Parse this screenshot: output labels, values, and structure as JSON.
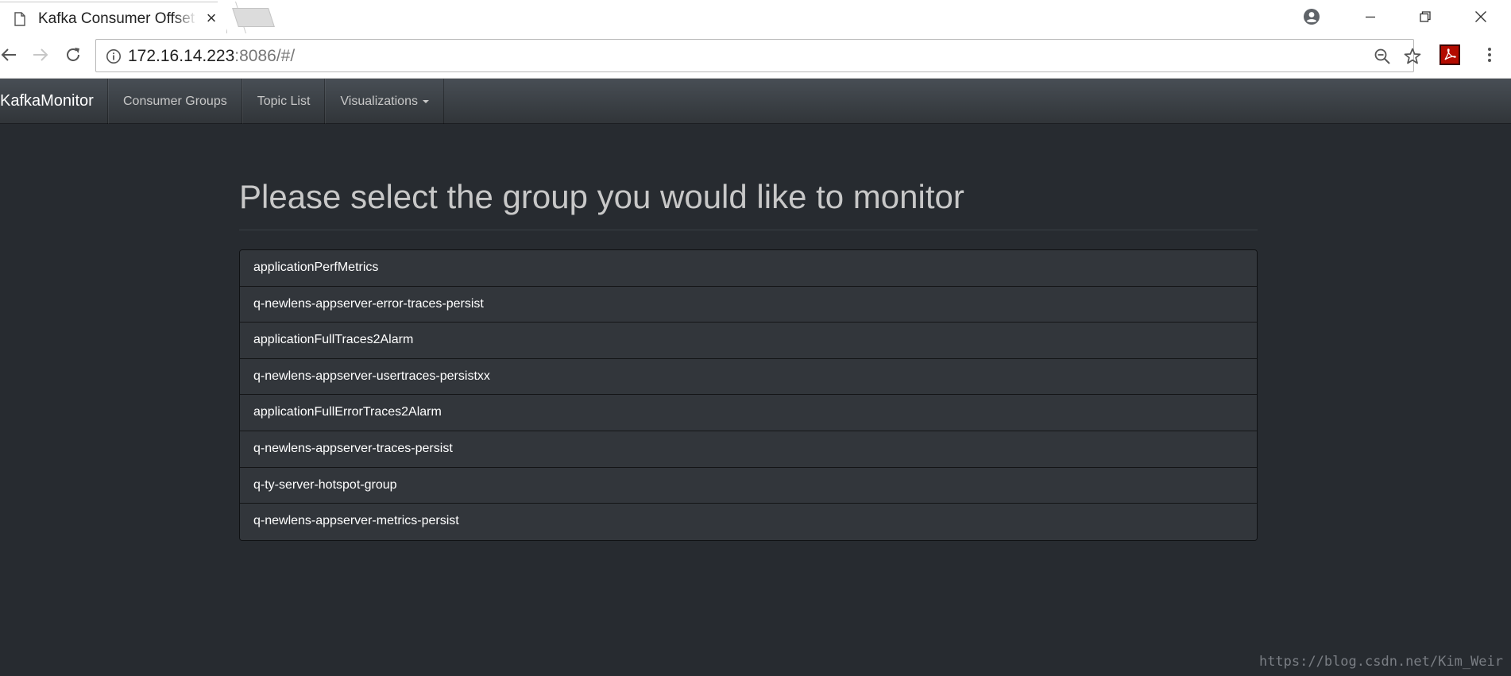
{
  "browser": {
    "tab_title": "Kafka Consumer Offset Monitor",
    "tab_close": "×",
    "url_host": "172.16.14.223",
    "url_rest": ":8086/#/",
    "icons": {
      "favicon": "page-icon",
      "back": "back-arrow-icon",
      "forward": "forward-arrow-icon",
      "reload": "reload-icon",
      "info": "info-icon",
      "zoom": "zoom-out-icon",
      "bookmark": "star-icon",
      "pdf": "pdf-extension-icon",
      "menu": "kebab-menu-icon",
      "profile": "profile-icon",
      "minimize": "minimize-icon",
      "restore": "restore-icon",
      "close": "close-icon"
    }
  },
  "app": {
    "brand": "KafkaMonitor",
    "nav": [
      {
        "label": "Consumer Groups"
      },
      {
        "label": "Topic List"
      },
      {
        "label": "Visualizations"
      }
    ]
  },
  "main": {
    "title": "Please select the group you would like to monitor",
    "groups": [
      "applicationPerfMetrics",
      "q-newlens-appserver-error-traces-persist",
      "applicationFullTraces2Alarm",
      "q-newlens-appserver-usertraces-persistxx",
      "applicationFullErrorTraces2Alarm",
      "q-newlens-appserver-traces-persist",
      "q-ty-server-hotspot-group",
      "q-newlens-appserver-metrics-persist"
    ]
  },
  "watermark": "https://blog.csdn.net/Kim_Weir",
  "colors": {
    "background": "#272b30",
    "navbar": "#3a3f44",
    "list_item": "#32363b",
    "title_text": "#c8c8c8"
  }
}
